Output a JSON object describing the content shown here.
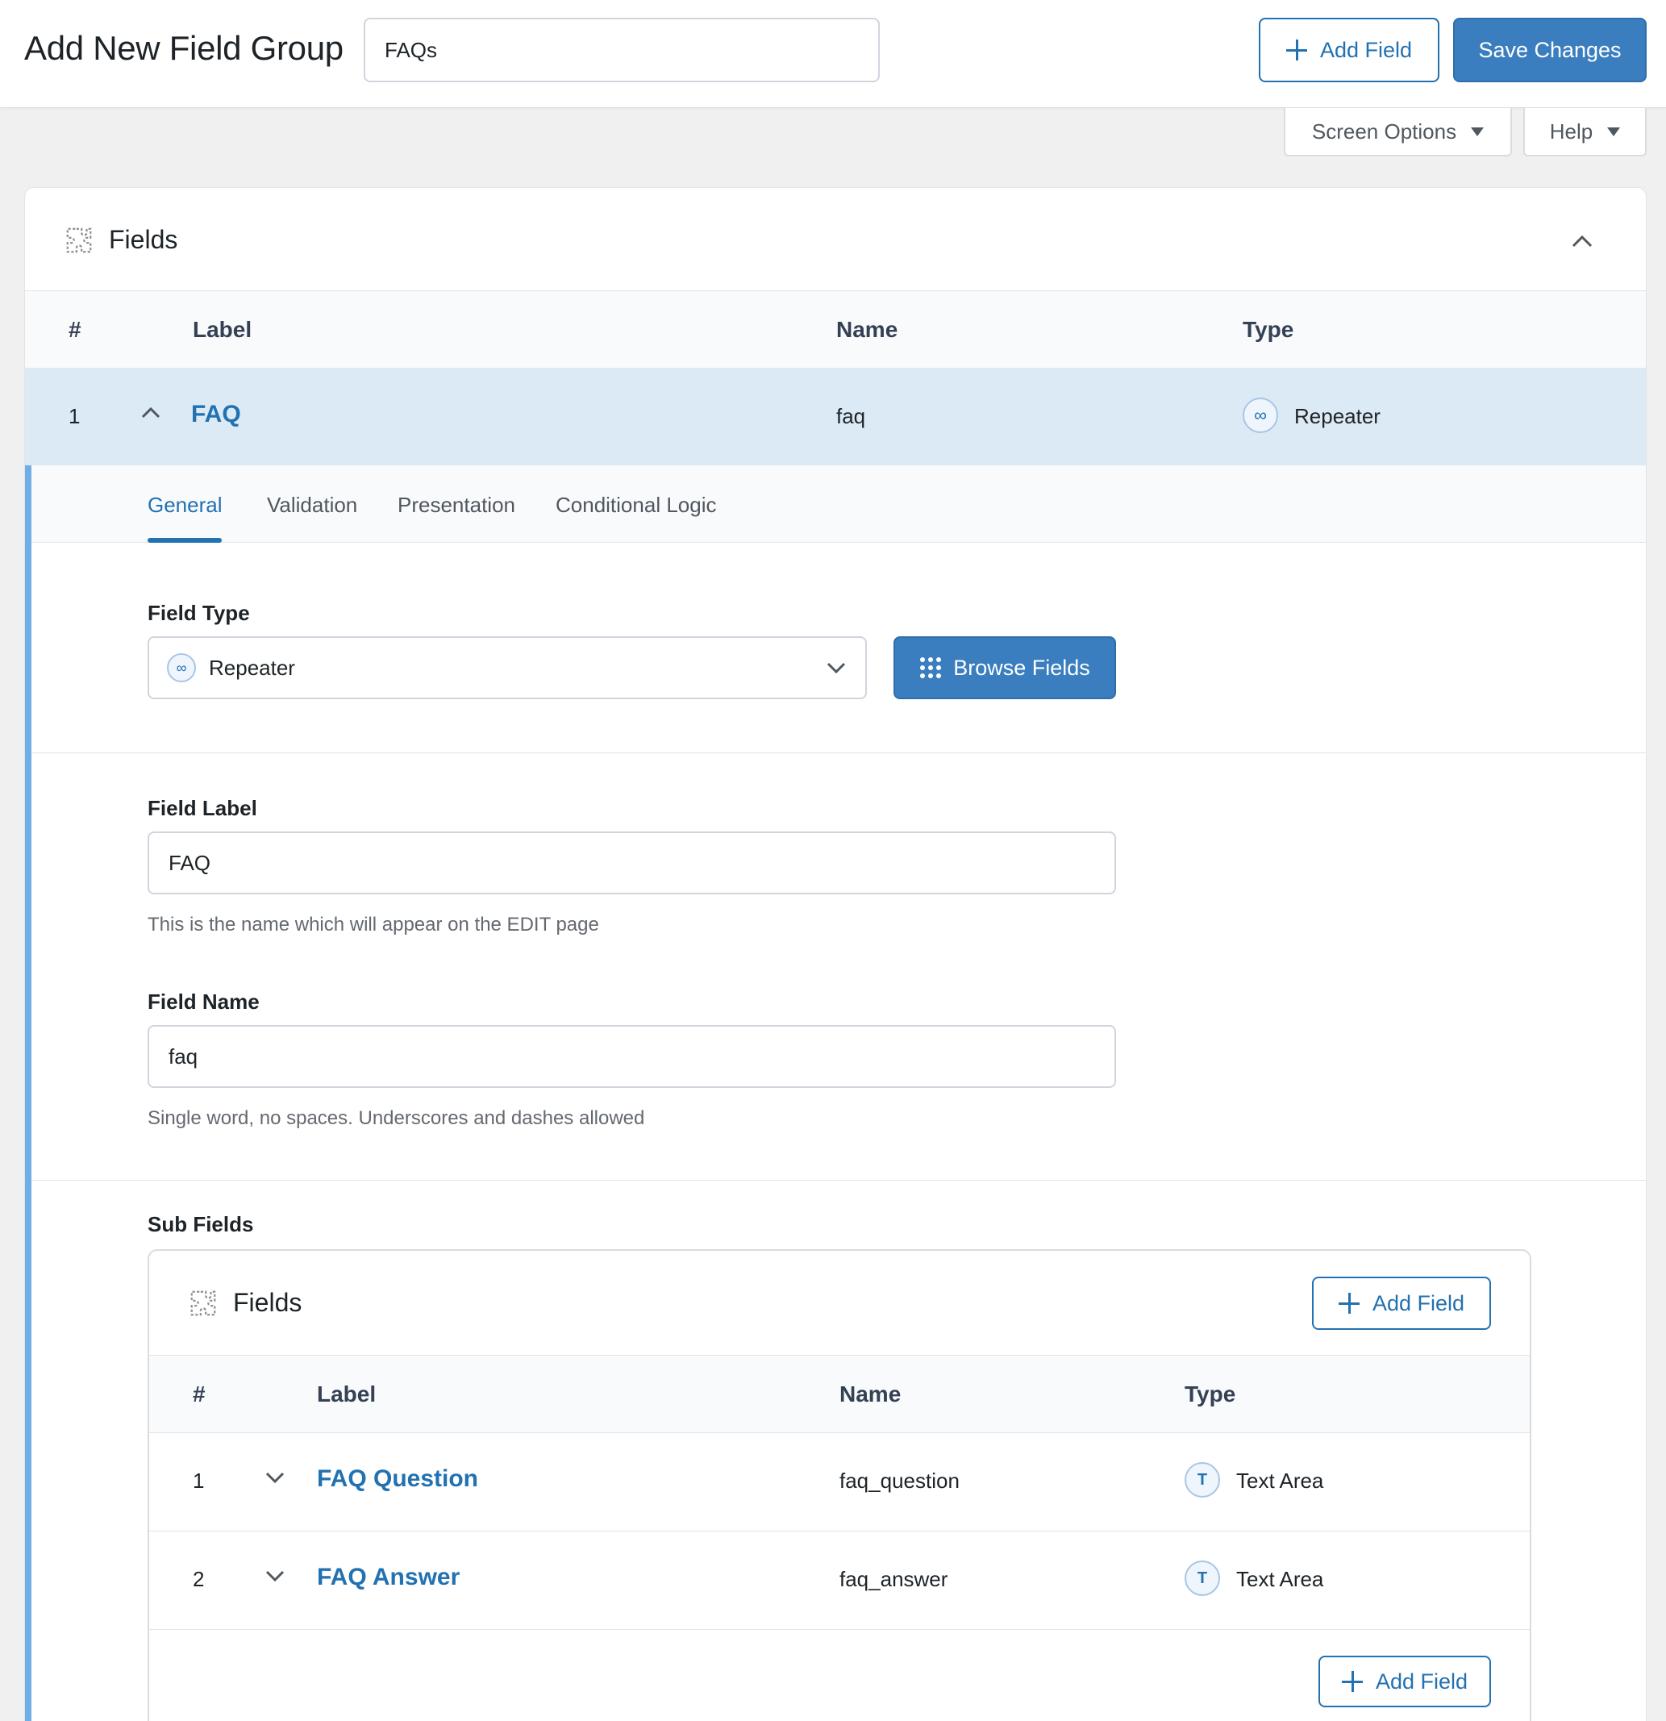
{
  "header": {
    "title": "Add New Field Group",
    "group_title_value": "FAQs",
    "add_field_label": "Add Field",
    "save_label": "Save Changes"
  },
  "screen_tabs": {
    "screen_options": "Screen Options",
    "help": "Help"
  },
  "fields_panel": {
    "title": "Fields",
    "columns": {
      "num": "#",
      "label": "Label",
      "name": "Name",
      "type": "Type"
    },
    "row": {
      "num": "1",
      "label": "FAQ",
      "name": "faq",
      "type": "Repeater"
    }
  },
  "settings": {
    "tabs": [
      "General",
      "Validation",
      "Presentation",
      "Conditional Logic"
    ],
    "field_type_label": "Field Type",
    "field_type_value": "Repeater",
    "browse_fields_label": "Browse Fields",
    "field_label_label": "Field Label",
    "field_label_value": "FAQ",
    "field_label_help": "This is the name which will appear on the EDIT page",
    "field_name_label": "Field Name",
    "field_name_value": "faq",
    "field_name_help": "Single word, no spaces. Underscores and dashes allowed",
    "sub_fields_label": "Sub Fields"
  },
  "sub_fields": {
    "title": "Fields",
    "add_field_label": "Add Field",
    "columns": {
      "num": "#",
      "label": "Label",
      "name": "Name",
      "type": "Type"
    },
    "rows": [
      {
        "num": "1",
        "label": "FAQ Question",
        "name": "faq_question",
        "type": "Text Area"
      },
      {
        "num": "2",
        "label": "FAQ Answer",
        "name": "faq_answer",
        "type": "Text Area"
      }
    ]
  },
  "colors": {
    "accent": "#2271b1",
    "primary_button": "#3a7ebf",
    "active_row": "#dceaf6"
  },
  "icons": [
    "plus-icon",
    "caret-down-icon",
    "puzzle-icon",
    "chevron-up-icon",
    "chevron-down-icon",
    "infinity-icon",
    "grid-icon",
    "text-area-icon"
  ]
}
